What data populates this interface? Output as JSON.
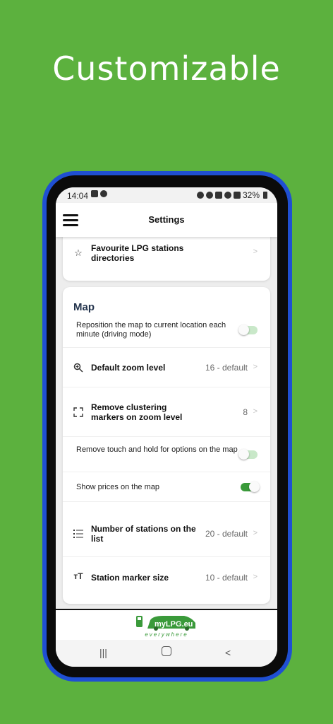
{
  "headline": "Customizable",
  "status_bar": {
    "time": "14:04",
    "battery": "32%"
  },
  "app_bar": {
    "title": "Settings"
  },
  "favourites_card": {
    "item_label": "Favourite LPG stations directories"
  },
  "map_section": {
    "title": "Map",
    "rows": [
      {
        "type": "toggle",
        "text": "Reposition the map to current location each minute (driving mode)",
        "enabled": false
      },
      {
        "type": "value",
        "icon": "zoom-icon",
        "label": "Default zoom level",
        "value": "16 - default"
      },
      {
        "type": "value",
        "icon": "cluster-icon",
        "label": "Remove clustering markers on zoom level",
        "value": "8"
      },
      {
        "type": "toggle",
        "text": "Remove touch and hold for options on the map",
        "enabled": false
      },
      {
        "type": "toggle",
        "text": "Show prices on the map",
        "enabled": true
      },
      {
        "type": "value",
        "icon": "list-icon",
        "label": "Number of stations on the list",
        "value": "20 - default"
      },
      {
        "type": "value",
        "icon": "text-size-icon",
        "label": "Station marker size",
        "value": "10 - default"
      }
    ]
  },
  "footer": {
    "logo_text": "myLPG.eu",
    "logo_subtext": "everywhere"
  },
  "colors": {
    "background": "#5cb13e",
    "phone_border": "#1f4fd2",
    "toggle_on": "#3a9a3a",
    "section_title": "#24344d"
  }
}
